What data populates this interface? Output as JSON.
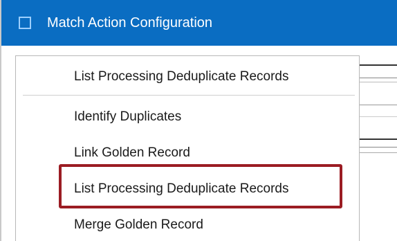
{
  "window": {
    "title": "Match Action Configuration",
    "icon": "window-icon"
  },
  "menu": {
    "current": "List Processing Deduplicate Records",
    "items": [
      {
        "label": "Identify Duplicates"
      },
      {
        "label": "Link Golden Record"
      },
      {
        "label": "List Processing Deduplicate Records",
        "highlighted": true
      },
      {
        "label": "Merge Golden Record"
      }
    ]
  },
  "colors": {
    "titlebar": "#0a6dc2",
    "highlight_border": "#9b1c23"
  }
}
